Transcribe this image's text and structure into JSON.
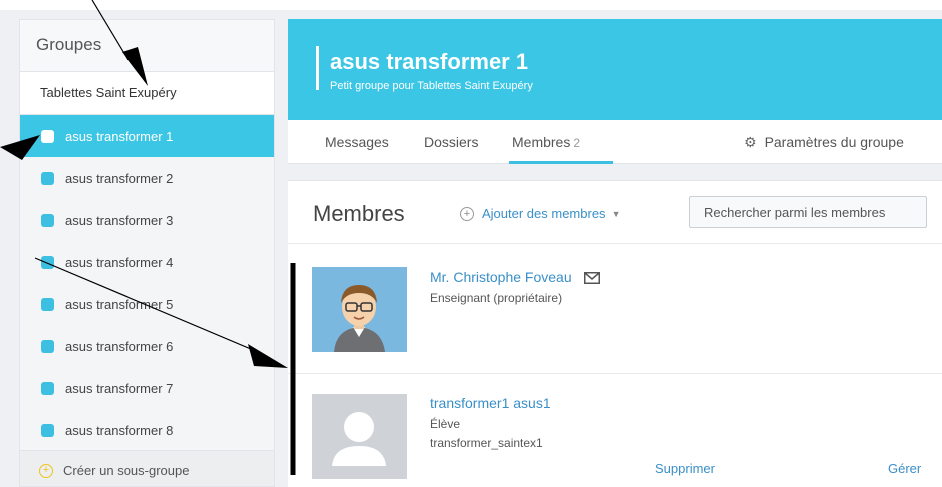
{
  "sidebar": {
    "header": "Groupes",
    "parent_group": "Tablettes Saint Exupéry",
    "items": [
      {
        "label": "asus transformer 1",
        "active": true
      },
      {
        "label": "asus transformer 2",
        "active": false
      },
      {
        "label": "asus transformer 3",
        "active": false
      },
      {
        "label": "asus transformer 4",
        "active": false
      },
      {
        "label": "asus transformer 5",
        "active": false
      },
      {
        "label": "asus transformer 6",
        "active": false
      },
      {
        "label": "asus transformer 7",
        "active": false
      },
      {
        "label": "asus transformer 8",
        "active": false
      }
    ],
    "create_label": "Créer un sous-groupe"
  },
  "group": {
    "title": "asus transformer 1",
    "subtitle": "Petit groupe pour Tablettes Saint Exupéry"
  },
  "tabs": {
    "messages": "Messages",
    "folders": "Dossiers",
    "members": "Membres",
    "members_count": "2",
    "settings": "Paramètres du groupe"
  },
  "members": {
    "title": "Membres",
    "add_label": "Ajouter des membres",
    "search_placeholder": "Rechercher parmi les membres",
    "list": [
      {
        "name": "Mr. Christophe Foveau",
        "role": "Enseignant (propriétaire)"
      },
      {
        "name": "transformer1 asus1",
        "role": "Élève",
        "login": "transformer_saintex1",
        "remove_label": "Supprimer",
        "manage_label": "Gérer"
      }
    ]
  },
  "colors": {
    "accent": "#3cc6e6",
    "link": "#3a8fc8",
    "create_icon": "#f0c419"
  },
  "icons": [
    "gear-icon",
    "mail-icon",
    "plus-circle-icon",
    "chevron-down-icon",
    "teacher-avatar",
    "default-avatar"
  ]
}
